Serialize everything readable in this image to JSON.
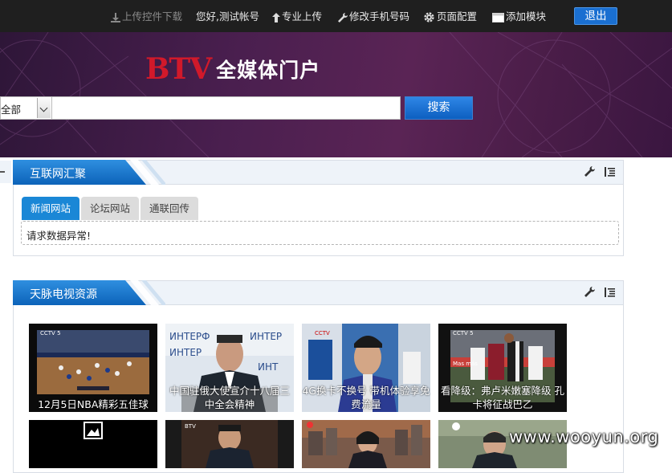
{
  "topbar": {
    "upload_plugin": "上传控件下载",
    "greeting": "您好,测试帐号",
    "pro_upload": "专业上传",
    "change_phone": "修改手机号码",
    "page_config": "页面配置",
    "add_module": "添加模块",
    "logout": "退出"
  },
  "banner": {
    "logo_btv": "BTV",
    "logo_text": "全媒体门户",
    "search_scope": "全部",
    "search_value": "",
    "search_button": "搜索"
  },
  "panels": {
    "internet": {
      "title": "互联网汇聚",
      "subtabs": [
        "新闻网站",
        "论坛网站",
        "通联回传"
      ],
      "message": "请求数据异常!"
    },
    "tianmai": {
      "title": "天脉电视资源",
      "videos": [
        {
          "caption": "12月5日NBA精彩五佳球"
        },
        {
          "caption": "中国驻俄大使宣介十八届三中全会精神"
        },
        {
          "caption": "4G换卡不换号 带机体验享免费流量"
        },
        {
          "caption": "看降级：弗卢米嫩塞降级 孔卡将征战巴乙"
        }
      ]
    }
  },
  "watermark": "www.wooyun.org",
  "colors": {
    "accent_blue": "#1a87d6",
    "banner_purple": "#4a1f4f",
    "brand_red": "#d1192a"
  }
}
